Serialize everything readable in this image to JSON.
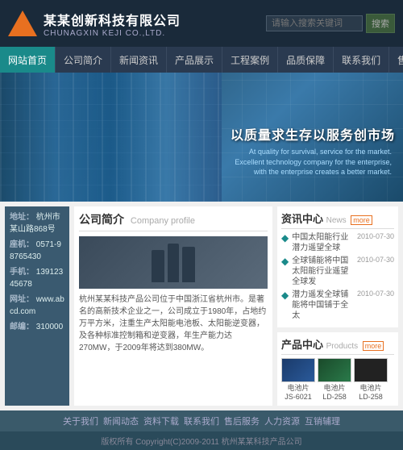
{
  "header": {
    "logo_cn": "某某创新科技有限公司",
    "logo_en": "CHUNAGXIN KEJI CO.,LTD.",
    "search_placeholder": "请输入搜索关键词",
    "search_btn": "搜索"
  },
  "nav": {
    "items": [
      {
        "label": "网站首页",
        "active": true
      },
      {
        "label": "公司简介",
        "active": false
      },
      {
        "label": "新闻资讯",
        "active": false
      },
      {
        "label": "产品展示",
        "active": false
      },
      {
        "label": "工程案例",
        "active": false
      },
      {
        "label": "品质保障",
        "active": false
      },
      {
        "label": "联系我们",
        "active": false
      },
      {
        "label": "售后服务",
        "active": false
      }
    ]
  },
  "banner": {
    "slogan": "以质量求生存以服务创市场",
    "sub": "At quality for survival, service for the market. Excellent technology company for the enterprise, with the enterprise creates a better market."
  },
  "sidebar": {
    "items": [
      {
        "label": "地址：",
        "value": "杭州市某山路868号"
      },
      {
        "label": "座机：",
        "value": "0571-98765430"
      },
      {
        "label": "手机：",
        "value": "13912345678"
      },
      {
        "label": "网址：",
        "value": "www.abcd.com"
      },
      {
        "label": "邮编：",
        "value": "310000"
      }
    ]
  },
  "company": {
    "section_title_cn": "公司简介",
    "section_title_en": "Company profile",
    "desc": "杭州某某科技产品公司位于中国浙江省杭州市。是著名的高新技术企业之一，公司成立于1980年，占地约万平方米，注重生产太阳能电池板、太阳能逆变器，及各种标准控制箱和逆变器，年生产能力达270MW，于2009年将达到380MW。"
  },
  "news": {
    "section_title_cn": "资讯中心",
    "section_title_en": "News",
    "more": "more",
    "items": [
      {
        "text": "中国太阳能行业潜力遥望全球",
        "date": "2010-07-30"
      },
      {
        "text": "全球铺能将中国太阳能行业遥望全球发",
        "date": "2010-07-30"
      },
      {
        "text": "潜力遥发全球铺能将中国铺于全太",
        "date": "2010-07-30"
      }
    ]
  },
  "products": {
    "section_title_cn": "产品中心",
    "section_title_en": "Products",
    "more": "more",
    "items": [
      {
        "name": "电池片 JS-6021",
        "type": "solar"
      },
      {
        "name": "电池片 LD-258",
        "type": "battery"
      },
      {
        "name": "电池片 LD-258",
        "type": "grid"
      }
    ]
  },
  "footer_nav": {
    "items": [
      "关于我们",
      "新闻动态",
      "资料下载",
      "联系我们",
      "售后服务",
      "人力资源",
      "互销辅理"
    ]
  },
  "footer_copy": {
    "text": "版权所有 Copyright(C)2009-2011 杭州某某科技产品公司"
  }
}
